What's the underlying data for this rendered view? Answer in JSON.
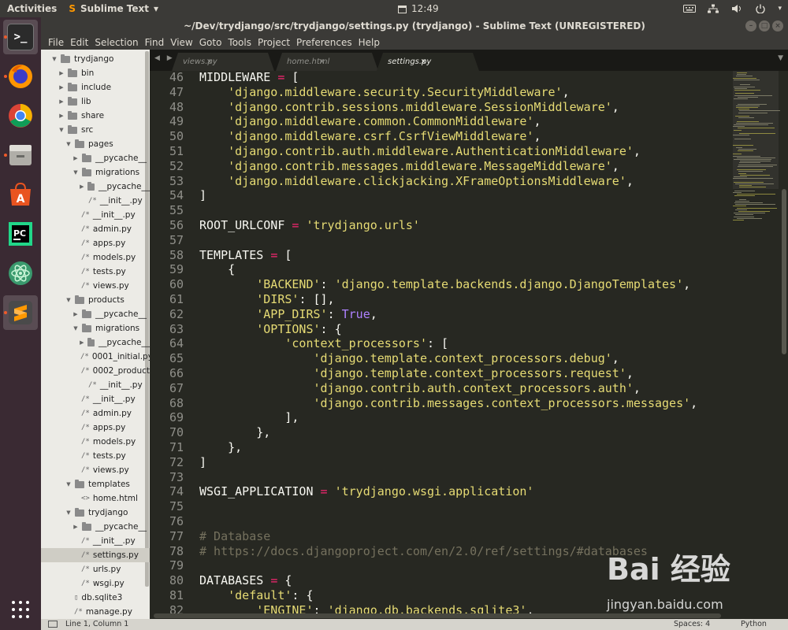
{
  "top_panel": {
    "activities": "Activities",
    "app_name": "Sublime Text",
    "app_menu_arrow": "▾",
    "calendar_icon": "calendar-icon",
    "time": "12:49"
  },
  "dock": {
    "apps": [
      {
        "name": "Terminal",
        "glyph": ">_",
        "color": "#2b2b2b",
        "active": true
      },
      {
        "name": "Firefox",
        "glyph": "",
        "color": "#e66000",
        "running": true
      },
      {
        "name": "Chrome",
        "glyph": "",
        "color": "#4285f4"
      },
      {
        "name": "Files",
        "glyph": "",
        "color": "#8d8d89"
      },
      {
        "name": "Ubuntu Software",
        "glyph": "A",
        "color": "#e95420"
      },
      {
        "name": "PyCharm",
        "glyph": "PC",
        "color": "#21d789"
      },
      {
        "name": "Atom",
        "glyph": "⚛",
        "color": "#66595c"
      },
      {
        "name": "Sublime Text",
        "glyph": "S",
        "color": "#ff9800",
        "active": true,
        "running": true
      }
    ],
    "show_apps_icon": "grid-icon"
  },
  "window": {
    "title": "~/Dev/trydjango/src/trydjango/settings.py (trydjango) - Sublime Text (UNREGISTERED)",
    "menu": [
      "File",
      "Edit",
      "Selection",
      "Find",
      "View",
      "Goto",
      "Tools",
      "Project",
      "Preferences",
      "Help"
    ]
  },
  "sidebar": {
    "items": [
      {
        "label": "trydjango",
        "type": "folder",
        "depth": 0,
        "expanded": true
      },
      {
        "label": "bin",
        "type": "folder",
        "depth": 1
      },
      {
        "label": "include",
        "type": "folder",
        "depth": 1
      },
      {
        "label": "lib",
        "type": "folder",
        "depth": 1
      },
      {
        "label": "share",
        "type": "folder",
        "depth": 1
      },
      {
        "label": "src",
        "type": "folder",
        "depth": 1,
        "expanded": true
      },
      {
        "label": "pages",
        "type": "folder",
        "depth": 2,
        "expanded": true
      },
      {
        "label": "__pycache__",
        "type": "folder",
        "depth": 3
      },
      {
        "label": "migrations",
        "type": "folder",
        "depth": 3,
        "expanded": true
      },
      {
        "label": "__pycache__",
        "type": "folder",
        "depth": 4
      },
      {
        "label": "__init__.py",
        "type": "file",
        "depth": 4
      },
      {
        "label": "__init__.py",
        "type": "file",
        "depth": 3
      },
      {
        "label": "admin.py",
        "type": "file",
        "depth": 3
      },
      {
        "label": "apps.py",
        "type": "file",
        "depth": 3
      },
      {
        "label": "models.py",
        "type": "file",
        "depth": 3
      },
      {
        "label": "tests.py",
        "type": "file",
        "depth": 3
      },
      {
        "label": "views.py",
        "type": "file",
        "depth": 3
      },
      {
        "label": "products",
        "type": "folder",
        "depth": 2,
        "expanded": true
      },
      {
        "label": "__pycache__",
        "type": "folder",
        "depth": 3
      },
      {
        "label": "migrations",
        "type": "folder",
        "depth": 3,
        "expanded": true
      },
      {
        "label": "__pycache__",
        "type": "folder",
        "depth": 4
      },
      {
        "label": "0001_initial.py",
        "type": "file",
        "depth": 4
      },
      {
        "label": "0002_product",
        "type": "file",
        "depth": 4
      },
      {
        "label": "__init__.py",
        "type": "file",
        "depth": 4
      },
      {
        "label": "__init__.py",
        "type": "file",
        "depth": 3
      },
      {
        "label": "admin.py",
        "type": "file",
        "depth": 3
      },
      {
        "label": "apps.py",
        "type": "file",
        "depth": 3
      },
      {
        "label": "models.py",
        "type": "file",
        "depth": 3
      },
      {
        "label": "tests.py",
        "type": "file",
        "depth": 3
      },
      {
        "label": "views.py",
        "type": "file",
        "depth": 3
      },
      {
        "label": "templates",
        "type": "folder",
        "depth": 2,
        "expanded": true
      },
      {
        "label": "home.html",
        "type": "html",
        "depth": 3
      },
      {
        "label": "trydjango",
        "type": "folder",
        "depth": 2,
        "expanded": true
      },
      {
        "label": "__pycache__",
        "type": "folder",
        "depth": 3
      },
      {
        "label": "__init__.py",
        "type": "file",
        "depth": 3
      },
      {
        "label": "settings.py",
        "type": "file",
        "depth": 3,
        "selected": true
      },
      {
        "label": "urls.py",
        "type": "file",
        "depth": 3
      },
      {
        "label": "wsgi.py",
        "type": "file",
        "depth": 3
      },
      {
        "label": "db.sqlite3",
        "type": "doc",
        "depth": 2
      },
      {
        "label": "manage.py",
        "type": "file",
        "depth": 2
      }
    ]
  },
  "tabs": [
    {
      "label": "views.py",
      "close": "×"
    },
    {
      "label": "home.html",
      "close": "×"
    },
    {
      "label": "settings.py",
      "close": "×",
      "active": true
    }
  ],
  "tab_nav": "◀ ▶",
  "tab_dropdown": "▼",
  "editor": {
    "lines": [
      {
        "n": "46",
        "tokens": [
          [
            "p",
            "MIDDLEWARE "
          ],
          [
            "op",
            "="
          ],
          [
            "p",
            " ["
          ]
        ]
      },
      {
        "n": "47",
        "tokens": [
          [
            "p",
            "    "
          ],
          [
            "str",
            "'django.middleware.security.SecurityMiddleware'"
          ],
          [
            "p",
            ","
          ]
        ]
      },
      {
        "n": "48",
        "tokens": [
          [
            "p",
            "    "
          ],
          [
            "str",
            "'django.contrib.sessions.middleware.SessionMiddleware'"
          ],
          [
            "p",
            ","
          ]
        ]
      },
      {
        "n": "49",
        "tokens": [
          [
            "p",
            "    "
          ],
          [
            "str",
            "'django.middleware.common.CommonMiddleware'"
          ],
          [
            "p",
            ","
          ]
        ]
      },
      {
        "n": "50",
        "tokens": [
          [
            "p",
            "    "
          ],
          [
            "str",
            "'django.middleware.csrf.CsrfViewMiddleware'"
          ],
          [
            "p",
            ","
          ]
        ]
      },
      {
        "n": "51",
        "tokens": [
          [
            "p",
            "    "
          ],
          [
            "str",
            "'django.contrib.auth.middleware.AuthenticationMiddleware'"
          ],
          [
            "p",
            ","
          ]
        ]
      },
      {
        "n": "52",
        "tokens": [
          [
            "p",
            "    "
          ],
          [
            "str",
            "'django.contrib.messages.middleware.MessageMiddleware'"
          ],
          [
            "p",
            ","
          ]
        ]
      },
      {
        "n": "53",
        "tokens": [
          [
            "p",
            "    "
          ],
          [
            "str",
            "'django.middleware.clickjacking.XFrameOptionsMiddleware'"
          ],
          [
            "p",
            ","
          ]
        ]
      },
      {
        "n": "54",
        "tokens": [
          [
            "p",
            "]"
          ]
        ]
      },
      {
        "n": "55",
        "tokens": []
      },
      {
        "n": "56",
        "tokens": [
          [
            "p",
            "ROOT_URLCONF "
          ],
          [
            "op",
            "="
          ],
          [
            "p",
            " "
          ],
          [
            "str",
            "'trydjango.urls'"
          ]
        ]
      },
      {
        "n": "57",
        "tokens": []
      },
      {
        "n": "58",
        "tokens": [
          [
            "p",
            "TEMPLATES "
          ],
          [
            "op",
            "="
          ],
          [
            "p",
            " ["
          ]
        ]
      },
      {
        "n": "59",
        "tokens": [
          [
            "p",
            "    {"
          ]
        ]
      },
      {
        "n": "60",
        "tokens": [
          [
            "p",
            "        "
          ],
          [
            "str",
            "'BACKEND'"
          ],
          [
            "p",
            ": "
          ],
          [
            "str",
            "'django.template.backends.django.DjangoTemplates'"
          ],
          [
            "p",
            ","
          ]
        ]
      },
      {
        "n": "61",
        "tokens": [
          [
            "p",
            "        "
          ],
          [
            "str",
            "'DIRS'"
          ],
          [
            "p",
            ": [],"
          ]
        ]
      },
      {
        "n": "62",
        "tokens": [
          [
            "p",
            "        "
          ],
          [
            "str",
            "'APP_DIRS'"
          ],
          [
            "p",
            ": "
          ],
          [
            "const",
            "True"
          ],
          [
            "p",
            ","
          ]
        ]
      },
      {
        "n": "63",
        "tokens": [
          [
            "p",
            "        "
          ],
          [
            "str",
            "'OPTIONS'"
          ],
          [
            "p",
            ": {"
          ]
        ]
      },
      {
        "n": "64",
        "tokens": [
          [
            "p",
            "            "
          ],
          [
            "str",
            "'context_processors'"
          ],
          [
            "p",
            ": ["
          ]
        ]
      },
      {
        "n": "65",
        "tokens": [
          [
            "p",
            "                "
          ],
          [
            "str",
            "'django.template.context_processors.debug'"
          ],
          [
            "p",
            ","
          ]
        ]
      },
      {
        "n": "66",
        "tokens": [
          [
            "p",
            "                "
          ],
          [
            "str",
            "'django.template.context_processors.request'"
          ],
          [
            "p",
            ","
          ]
        ]
      },
      {
        "n": "67",
        "tokens": [
          [
            "p",
            "                "
          ],
          [
            "str",
            "'django.contrib.auth.context_processors.auth'"
          ],
          [
            "p",
            ","
          ]
        ]
      },
      {
        "n": "68",
        "tokens": [
          [
            "p",
            "                "
          ],
          [
            "str",
            "'django.contrib.messages.context_processors.messages'"
          ],
          [
            "p",
            ","
          ]
        ]
      },
      {
        "n": "69",
        "tokens": [
          [
            "p",
            "            ],"
          ]
        ]
      },
      {
        "n": "70",
        "tokens": [
          [
            "p",
            "        },"
          ]
        ]
      },
      {
        "n": "71",
        "tokens": [
          [
            "p",
            "    },"
          ]
        ]
      },
      {
        "n": "72",
        "tokens": [
          [
            "p",
            "]"
          ]
        ]
      },
      {
        "n": "73",
        "tokens": []
      },
      {
        "n": "74",
        "tokens": [
          [
            "p",
            "WSGI_APPLICATION "
          ],
          [
            "op",
            "="
          ],
          [
            "p",
            " "
          ],
          [
            "str",
            "'trydjango.wsgi.application'"
          ]
        ]
      },
      {
        "n": "75",
        "tokens": []
      },
      {
        "n": "76",
        "tokens": []
      },
      {
        "n": "77",
        "tokens": [
          [
            "com",
            "# Database"
          ]
        ]
      },
      {
        "n": "78",
        "tokens": [
          [
            "com",
            "# https://docs.djangoproject.com/en/2.0/ref/settings/#databases"
          ]
        ]
      },
      {
        "n": "79",
        "tokens": []
      },
      {
        "n": "80",
        "tokens": [
          [
            "p",
            "DATABASES "
          ],
          [
            "op",
            "="
          ],
          [
            "p",
            " {"
          ]
        ]
      },
      {
        "n": "81",
        "tokens": [
          [
            "p",
            "    "
          ],
          [
            "str",
            "'default'"
          ],
          [
            "p",
            ": {"
          ]
        ]
      },
      {
        "n": "82",
        "tokens": [
          [
            "p",
            "        "
          ],
          [
            "str",
            "'ENGINE'"
          ],
          [
            "p",
            ": "
          ],
          [
            "str",
            "'django.db.backends.sqlite3'"
          ],
          [
            "p",
            ","
          ]
        ]
      }
    ]
  },
  "status": {
    "position": "Line 1, Column 1",
    "spaces": "Spaces: 4",
    "syntax": "Python"
  },
  "watermark": {
    "brand": "Bai 经验",
    "url": "jingyan.baidu.com"
  },
  "colors": {
    "editor_bg": "#272822",
    "string": "#e6db74",
    "operator": "#f92672",
    "constant": "#ae81ff",
    "comment": "#75715e"
  }
}
